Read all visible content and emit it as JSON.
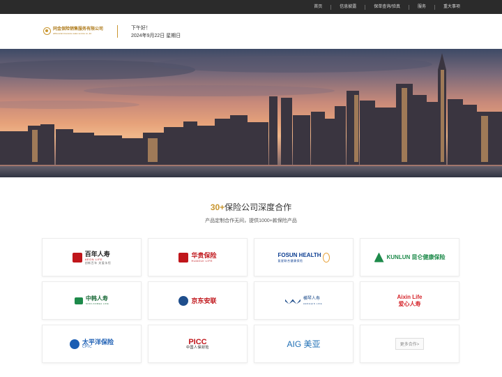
{
  "nav": {
    "items": [
      "首页",
      "信息披露",
      "保单查询/验真",
      "服务",
      "重大事项"
    ]
  },
  "header": {
    "logo": {
      "cn": "同金保险销售服务有限公司",
      "en": "allfinancial insurance sales service co.,ltd"
    },
    "greeting": "下午好！",
    "date": "2024年9月22日 星期日"
  },
  "partners": {
    "title_accent": "30+",
    "title_rest": "保险公司深度合作",
    "subtitle": "产品定制合作无间，提供1000+款保险产品",
    "logos": [
      {
        "cn": "百年人寿",
        "en": "AEON LIFE",
        "tagline": "创新百年 关爱永恒",
        "color": "#c0161b",
        "icon": "aeon-life-icon"
      },
      {
        "cn": "华贵保险",
        "en": "HUAGUI LIFE",
        "color": "#c0161b",
        "icon": "huagui-icon"
      },
      {
        "cn": "FOSUN HEALTH",
        "en": "复星联合健康保险",
        "color": "#0b3d91",
        "icon": "fosun-icon"
      },
      {
        "cn": "KUNLUN 昆仑健康保险",
        "en": "",
        "color": "#1d8a4a",
        "icon": "kunlun-icon"
      },
      {
        "cn": "中韩人寿",
        "en": "SINO-KOREA LIFE",
        "color": "#1d8a4a",
        "icon": "sino-korea-icon"
      },
      {
        "cn": "京东安联",
        "en": "",
        "color": "#c0161b",
        "icon": "jd-allianz-icon"
      },
      {
        "cn": "横琴人寿",
        "en": "HENGQIN LIFE",
        "color": "#1f4e8c",
        "icon": "hengqin-icon"
      },
      {
        "cn": "Aixin Life 爱心人寿",
        "en": "",
        "color": "#d6262c",
        "icon": "aixin-icon"
      },
      {
        "cn": "太平洋保险",
        "en": "CPIC",
        "color": "#1a5db3",
        "icon": "cpic-icon"
      },
      {
        "cn": "PICC",
        "en": "中国人保财险",
        "color": "#c0161b",
        "icon": "picc-icon"
      },
      {
        "cn": "AIG 美亚",
        "en": "",
        "color": "#1f6fb5",
        "icon": "aig-icon"
      }
    ],
    "more_label": "更多合作>"
  }
}
